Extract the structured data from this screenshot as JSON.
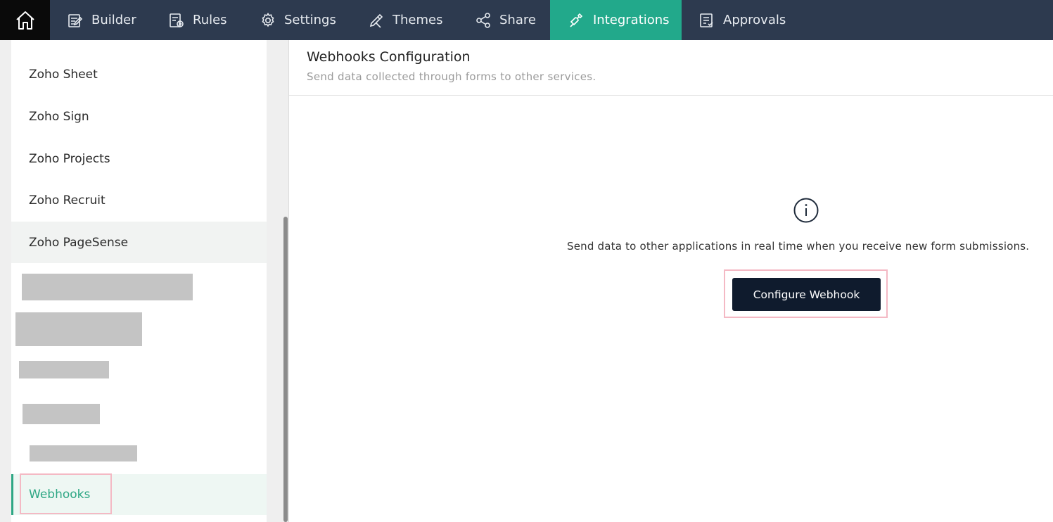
{
  "nav": {
    "items": [
      {
        "label": "Builder",
        "icon": "builder-icon"
      },
      {
        "label": "Rules",
        "icon": "rules-icon"
      },
      {
        "label": "Settings",
        "icon": "gear-icon"
      },
      {
        "label": "Themes",
        "icon": "brush-icon"
      },
      {
        "label": "Share",
        "icon": "share-icon"
      },
      {
        "label": "Integrations",
        "icon": "plug-icon",
        "active": true
      },
      {
        "label": "Approvals",
        "icon": "approvals-icon"
      }
    ]
  },
  "sidebar": {
    "items": [
      {
        "label": "Zoho Sheet"
      },
      {
        "label": "Zoho Sign"
      },
      {
        "label": "Zoho Projects"
      },
      {
        "label": "Zoho Recruit"
      },
      {
        "label": "Zoho PageSense"
      },
      {
        "label": "Webhooks",
        "active": true
      }
    ]
  },
  "main": {
    "title": "Webhooks Configuration",
    "subtitle": "Send data collected through forms to other services.",
    "empty_message": "Send data to other applications in real time when you receive new form submissions.",
    "configure_button": "Configure Webhook"
  },
  "colors": {
    "nav_bg": "#2d3a4f",
    "accent": "#22a98b",
    "button_bg": "#0f1b2d"
  }
}
